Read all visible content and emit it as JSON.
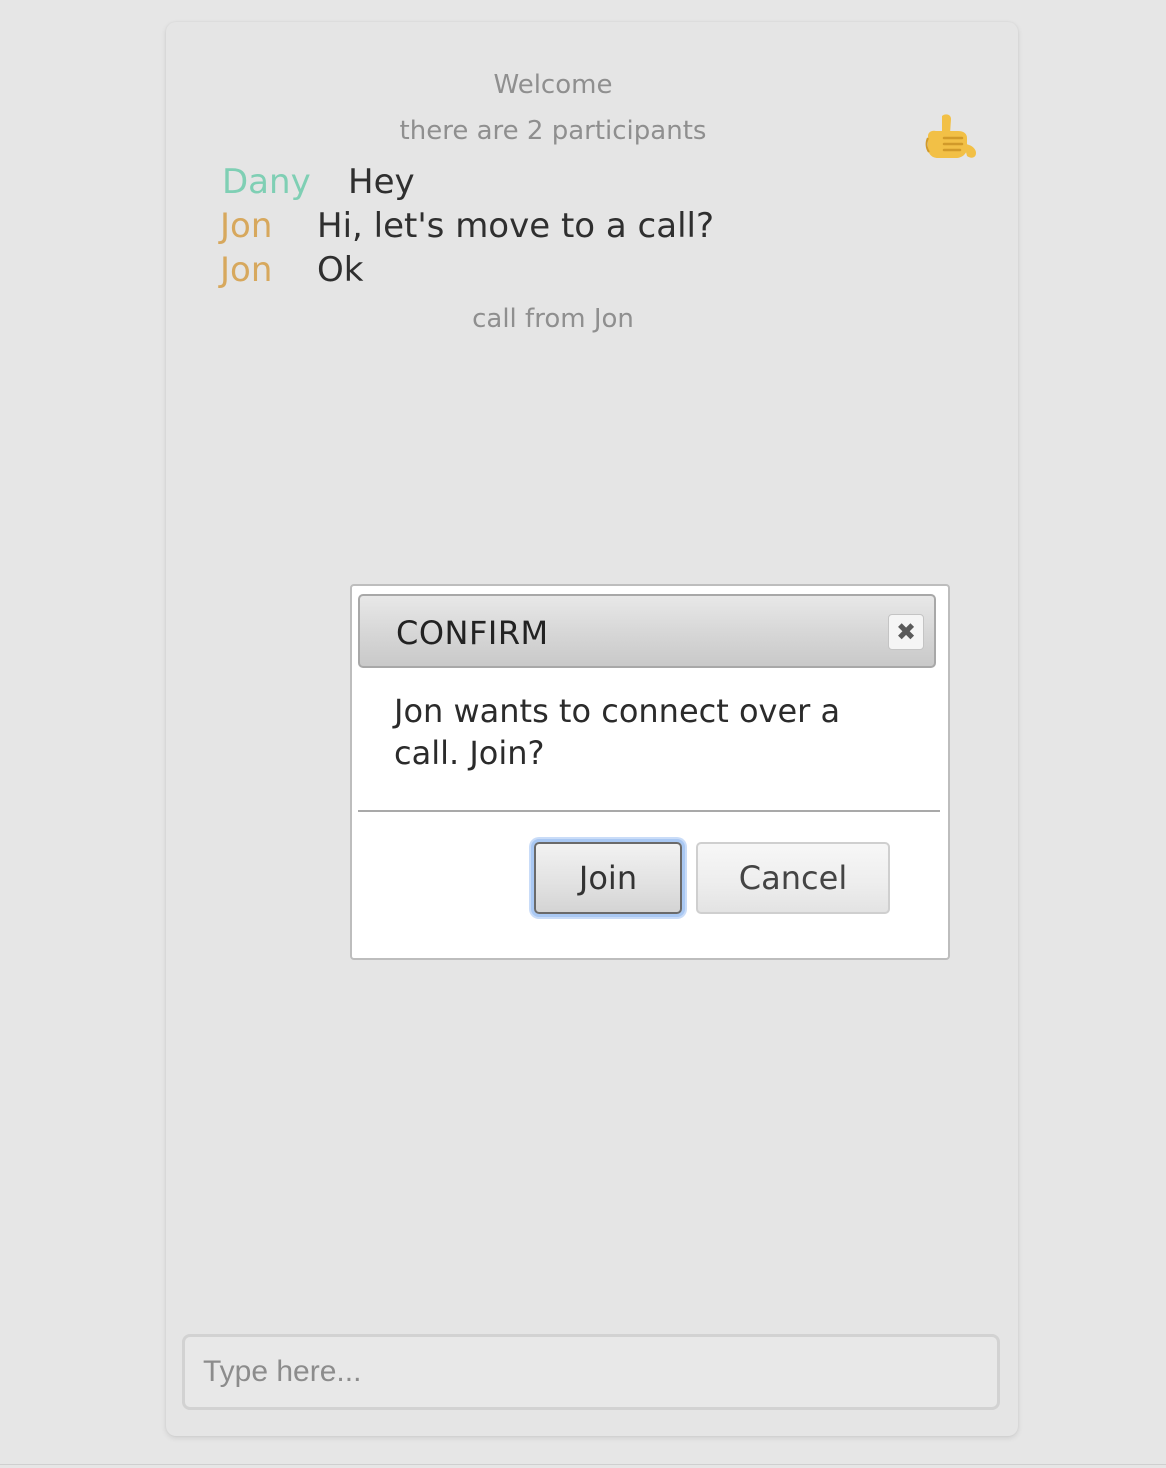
{
  "chat": {
    "welcome": "Welcome",
    "participants": "there are 2 participants",
    "messages": [
      {
        "author": "Dany",
        "text": "Hey"
      },
      {
        "author": "Jon",
        "text": "Hi, let's move to a call?"
      },
      {
        "author": "Jon",
        "text": "Ok"
      }
    ],
    "call_notice": "call from Jon",
    "call_icon": "call-me-hand-icon",
    "author_colors": {
      "Dany": "#7fcfb4",
      "Jon": "#d7a85d"
    }
  },
  "input": {
    "placeholder": "Type here..."
  },
  "dialog": {
    "title": "CONFIRM",
    "close_icon": "close-icon",
    "message": "Jon wants to connect over a call. Join?",
    "join_label": "Join",
    "cancel_label": "Cancel"
  }
}
